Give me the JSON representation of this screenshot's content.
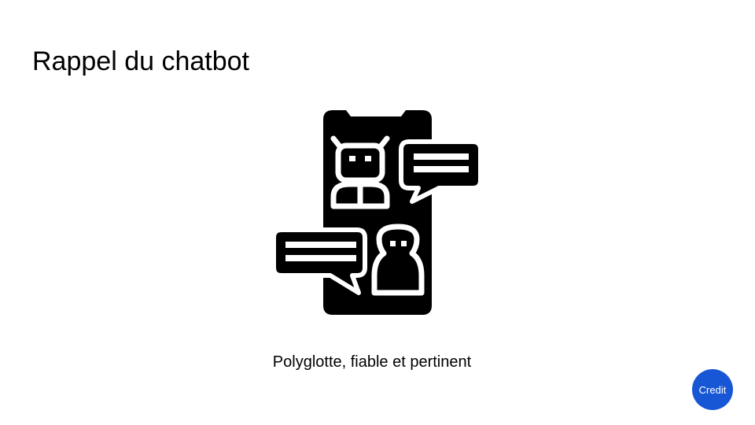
{
  "slide": {
    "title": "Rappel du chatbot",
    "caption": "Polyglotte, fiable et pertinent",
    "credit_label": "Credit"
  },
  "illustration": {
    "icon": "chatbot-smartphone-icon",
    "parts": [
      "smartphone-icon",
      "robot-icon",
      "user-icon",
      "speech-bubble-icon"
    ]
  },
  "colors": {
    "background": "#ffffff",
    "text": "#000000",
    "icon": "#000000",
    "credit_button": "#1757d6",
    "credit_text": "#ffffff"
  }
}
